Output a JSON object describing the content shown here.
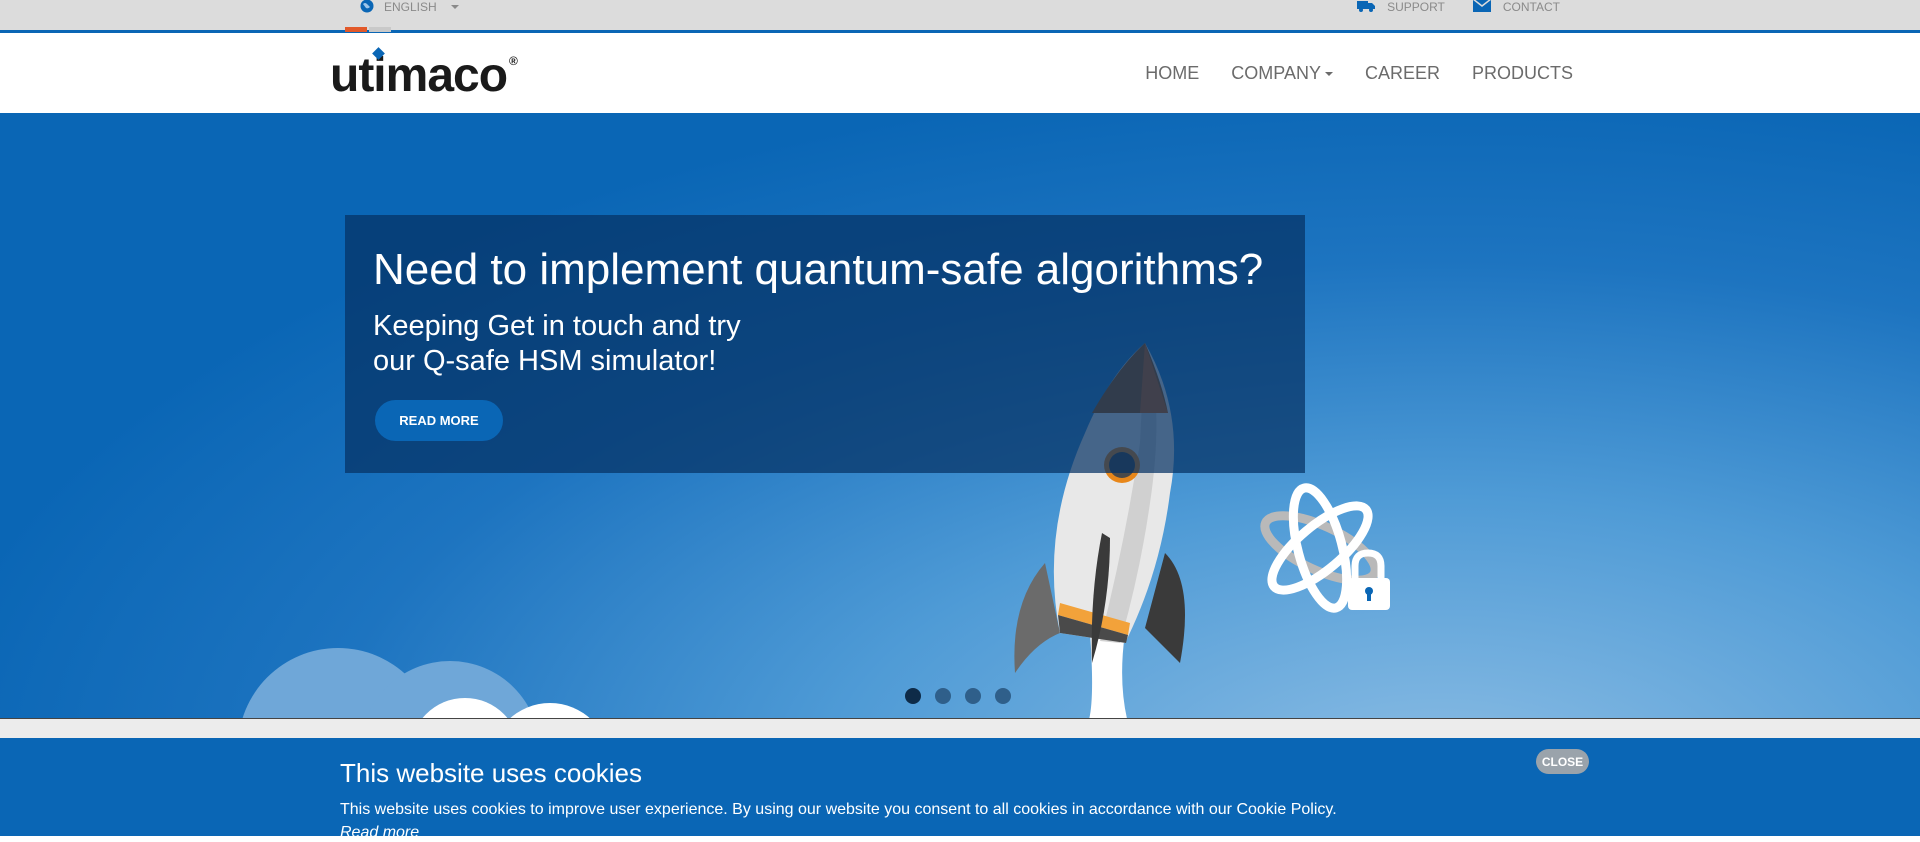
{
  "topbar": {
    "language": "ENGLISH",
    "support": "SUPPORT",
    "contact": "CONTACT"
  },
  "header": {
    "logo_text": "utimaco",
    "logo_mark": "®",
    "nav": {
      "home": "HOME",
      "company": "COMPANY",
      "career": "CAREER",
      "products": "PRODUCTS"
    }
  },
  "hero": {
    "title": "Need to implement quantum-safe algorithms?",
    "subtitle_line1": "Keeping Get in touch and try",
    "subtitle_line2": "our Q-safe HSM simulator!",
    "button": "READ MORE",
    "slides": 4,
    "active_slide": 1
  },
  "cookie": {
    "title": "This website uses cookies",
    "text": "This website uses cookies to improve user experience. By using our website you consent to all cookies in accordance with our Cookie Policy.",
    "link": "Read more",
    "close": "CLOSE"
  },
  "colors": {
    "brand_blue": "#0a66b5",
    "accent_orange": "#e2592a"
  },
  "icons": [
    "globe-icon",
    "truck-icon",
    "envelope-icon",
    "rocket-illustration",
    "atom-lock-icon"
  ]
}
